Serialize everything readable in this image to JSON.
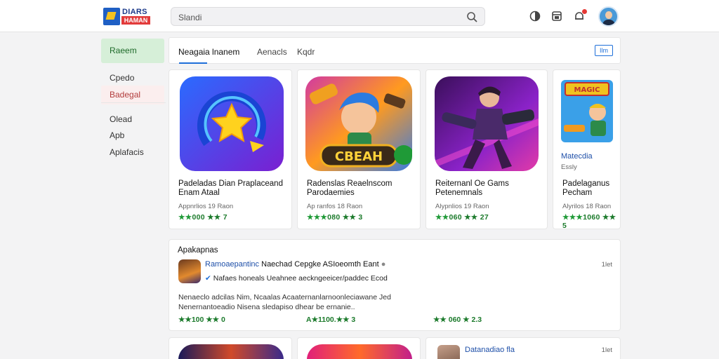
{
  "header": {
    "logo_top": "DIARS",
    "logo_bottom": "HAMAN",
    "search_placeholder": "Slandi"
  },
  "sidebar": {
    "items": [
      {
        "label": "Raeem"
      },
      {
        "label": "Cpedo"
      },
      {
        "label": "Badegal"
      },
      {
        "label": "Olead"
      },
      {
        "label": "Apb"
      },
      {
        "label": "Aplafacis"
      }
    ]
  },
  "tabs": {
    "items": [
      {
        "label": "Neagaia lnanem"
      },
      {
        "label": "Aenacls"
      },
      {
        "label": "Kqdr"
      }
    ],
    "button_label": "Ilm"
  },
  "cards": [
    {
      "title": "Padeladas Dian Praplaceand Enam Ataal",
      "meta": "Appnrlios 19 Raon",
      "rating_stars": "★★",
      "rating_value": "000",
      "rating_tail": "★★ 7"
    },
    {
      "title": "Radenslas Reaelnscom Parodaemies",
      "meta": "Ap ranfos 18 Raon",
      "rating_stars": "★★★",
      "rating_value": "080",
      "rating_tail": "★★ 3"
    },
    {
      "title": "Reiternanl Oe Gams Petenemnals",
      "meta": "Alypnlios 19 Raon",
      "rating_stars": "★★",
      "rating_value": "060",
      "rating_tail": "★★ 27"
    },
    {
      "title": "Padelaganus Pecham",
      "meta": "Alyrilos 18 Raon",
      "rating_stars": "★★★",
      "rating_value": "1060",
      "rating_tail": "★★ 5",
      "extra_name": "Matecdia",
      "extra_sub": "Essly",
      "art_badge": "MAGIC"
    }
  ],
  "card_art_text": "CBEAH",
  "reviews": {
    "title": "Apakapnas",
    "app_name": "Ramoaepantinc",
    "line1_rest": "Naechad Cepgke ASIoeomth Eant",
    "line2": "Nafaes  honeals Ueahnee aeckngeeicer/paddec Ecod",
    "time": "1let",
    "body": "Nenaeclo adcilas Nim, Ncaalas Acaaternanlarnoonleciawane Jed Nenernantoeadio Nisena sledapiso dhear be ernanie..",
    "ratings": [
      {
        "text": "★★100 ★★ 0"
      },
      {
        "text": "A★1100.★★ 3"
      },
      {
        "text": "★★ 060 ★ 2.3"
      }
    ]
  },
  "bottom": {
    "card4_title": "Datanadiao fla",
    "card4_time": "1let"
  }
}
